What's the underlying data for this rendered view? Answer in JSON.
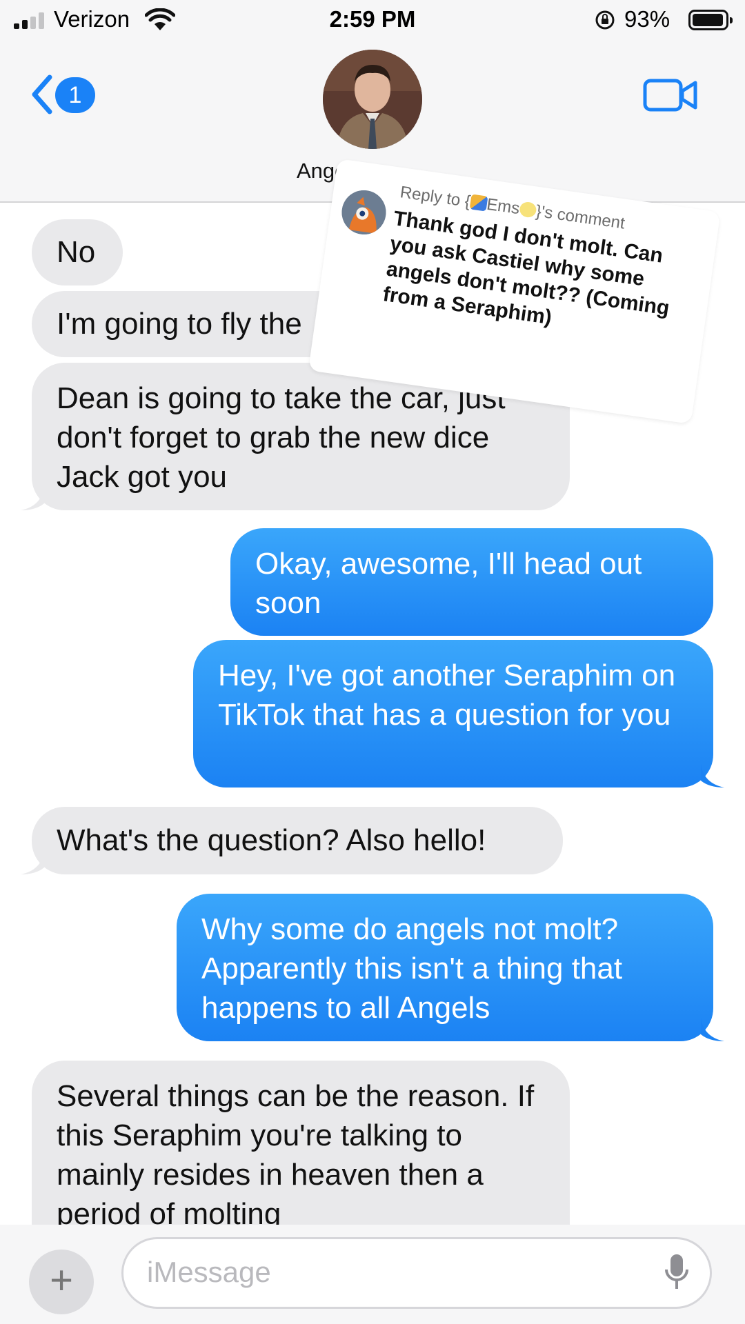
{
  "status_bar": {
    "carrier": "Verizon",
    "time": "2:59 PM",
    "battery_percent": "93%",
    "signal_bars": 2,
    "battery_level": 0.93
  },
  "header": {
    "back_badge": "1",
    "contact_name": "Angel I",
    "icons": [
      "back-chevron-icon",
      "video-call-icon"
    ]
  },
  "messages": [
    {
      "dir": "in",
      "text": "No"
    },
    {
      "dir": "in",
      "text": "I'm going to fly the"
    },
    {
      "dir": "in",
      "text": "Dean is going to take the car, just don't forget to grab the new dice Jack got you"
    },
    {
      "dir": "out",
      "text": "Okay, awesome, I'll head out soon"
    },
    {
      "dir": "out",
      "text": "Hey, I've got another Seraphim on TikTok that has a question for you"
    },
    {
      "dir": "in",
      "text": "What's the question? Also hello!"
    },
    {
      "dir": "out",
      "text": "Why some do angels not molt? Apparently this isn't a thing that happens to all Angels"
    },
    {
      "dir": "in",
      "text": "Several things can be the reason. If this Seraphim you're talking to mainly resides in heaven then a period of molting"
    }
  ],
  "reply_card": {
    "prefix": "Reply to {",
    "username": "Ems",
    "suffix": "}'s comment",
    "comment": "Thank god I don't molt. Can you ask Castiel why some angels don't molt?? (Coming from a Seraphim)"
  },
  "input_bar": {
    "placeholder": "iMessage",
    "plus_label": "+"
  },
  "colors": {
    "accent": "#1a82f7",
    "outgoing_bubble": "#2390f6",
    "incoming_bubble": "#e9e9eb"
  }
}
